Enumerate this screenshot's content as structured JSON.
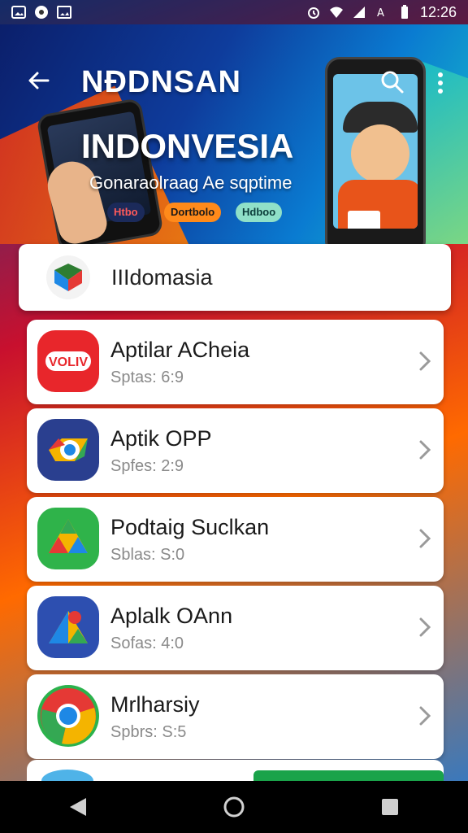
{
  "status_bar": {
    "time": "12:26"
  },
  "header": {
    "title": "NĐDNSAN"
  },
  "banner": {
    "heading": "INDONVESIA",
    "subtitle": "Gonaraolraag Ae sqptime",
    "chips": [
      "Htbo",
      "Dortbolo",
      "Hdboo"
    ]
  },
  "section": {
    "label": "IIIdomasia"
  },
  "apps": [
    {
      "name": "Aptilar ACheia",
      "meta": "Sptas: 6:9",
      "icon_color": "#e8262b",
      "icon_text": "VOLIV"
    },
    {
      "name": "Aptik OPP",
      "meta": "Spfes: 2:9",
      "icon_color": "#2a3f8f"
    },
    {
      "name": "Podtaig Suclkan",
      "meta": "Sblas: S:0",
      "icon_color": "#2fb34a"
    },
    {
      "name": "Aplalk OAnn",
      "meta": "Sofas: 4:0",
      "icon_color": "#2d4fb0"
    },
    {
      "name": "Mrlharsiy",
      "meta": "Spbrs: S:5",
      "icon_color": "#2bb24c"
    }
  ]
}
